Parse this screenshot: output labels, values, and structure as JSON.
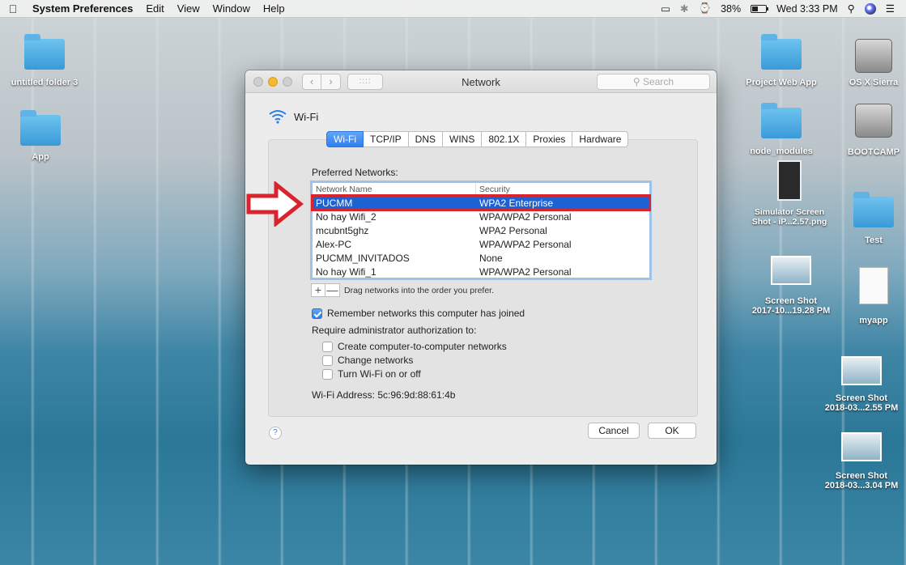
{
  "menubar": {
    "apple": "",
    "app": "System Preferences",
    "items": [
      "Edit",
      "View",
      "Window",
      "Help"
    ],
    "battery": "38%",
    "clock": "Wed 3:33 PM"
  },
  "desktop": {
    "left_icons": [
      "untitled folder 3",
      "App"
    ],
    "right_icons": {
      "project_web_app": "Project Web App",
      "os_x_sierra": "OS X Sierra",
      "node_modules": "node_modules",
      "bootcamp": "BOOTCAMP",
      "simulator": "Simulator Screen Shot - iP...2.57.png",
      "test": "Test",
      "screenshot1_line1": "Screen Shot",
      "screenshot1_line2": "2017-10...19.28 PM",
      "myapp": "myapp",
      "screenshot2_line1": "Screen Shot",
      "screenshot2_line2": "2018-03...2.55 PM",
      "screenshot3_line1": "Screen Shot",
      "screenshot3_line2": "2018-03...3.04 PM"
    }
  },
  "window": {
    "title": "Network",
    "search_placeholder": "Search",
    "grid_glyph": "::::",
    "service": "Wi-Fi",
    "tabs": [
      "Wi-Fi",
      "TCP/IP",
      "DNS",
      "WINS",
      "802.1X",
      "Proxies",
      "Hardware"
    ],
    "preferred_label": "Preferred Networks:",
    "columns": [
      "Network Name",
      "Security"
    ],
    "networks": [
      {
        "name": "PUCMM",
        "security": "WPA2 Enterprise"
      },
      {
        "name": "No hay Wifi_2",
        "security": "WPA/WPA2 Personal"
      },
      {
        "name": "mcubnt5ghz",
        "security": "WPA2 Personal"
      },
      {
        "name": "Alex-PC",
        "security": "WPA/WPA2 Personal"
      },
      {
        "name": "PUCMM_INVITADOS",
        "security": "None"
      },
      {
        "name": "No hay Wifi_1",
        "security": "WPA/WPA2 Personal"
      }
    ],
    "plus": "+",
    "minus": "—",
    "drag_hint": "Drag networks into the order you prefer.",
    "remember": "Remember networks this computer has joined",
    "require_admin": "Require administrator authorization to:",
    "options": [
      "Create computer-to-computer networks",
      "Change networks",
      "Turn Wi-Fi on or off"
    ],
    "wifi_address": "Wi-Fi Address:  5c:96:9d:88:61:4b",
    "help": "?",
    "cancel": "Cancel",
    "ok": "OK"
  },
  "colors": {
    "selection": "#1d62d2",
    "annotation": "#d9242d"
  }
}
